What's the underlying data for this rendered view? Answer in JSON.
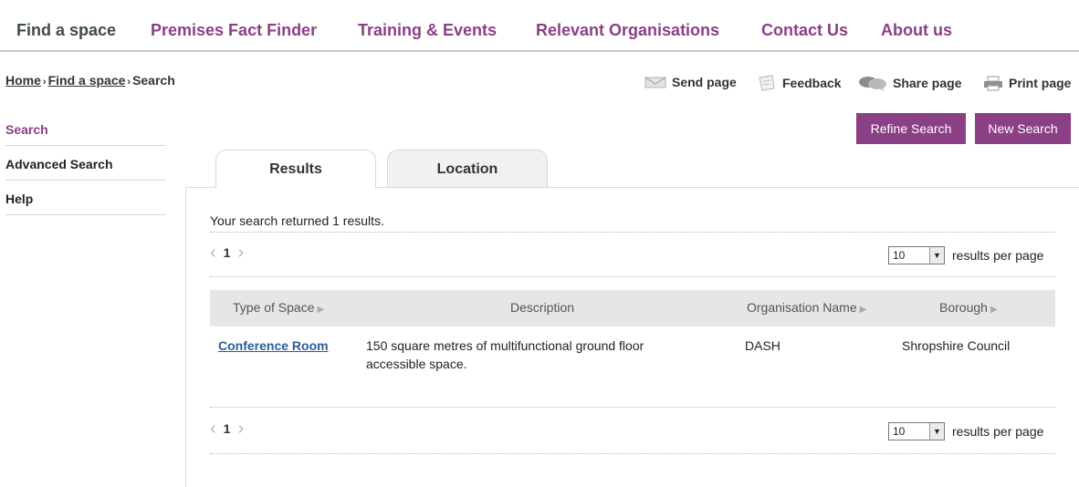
{
  "nav": {
    "items": [
      "Find a space",
      "Premises Fact Finder",
      "Training & Events",
      "Relevant Organisations",
      "Contact Us",
      "About us"
    ]
  },
  "breadcrumb": {
    "home": "Home",
    "find": "Find a space",
    "current": "Search"
  },
  "utility": {
    "send": "Send page",
    "feedback": "Feedback",
    "share": "Share page",
    "print": "Print page"
  },
  "sidebar": {
    "items": [
      "Search",
      "Advanced Search",
      "Help"
    ]
  },
  "buttons": {
    "refine": "Refine Search",
    "new": "New Search"
  },
  "tabs": {
    "results": "Results",
    "location": "Location"
  },
  "results": {
    "summary": "Your search returned 1 results.",
    "page": "1",
    "per_page_value": "10",
    "per_page_label": "results per page"
  },
  "table": {
    "headers": [
      "Type of Space",
      "Description",
      "Organisation Name",
      "Borough"
    ],
    "rows": [
      {
        "type": "Conference Room",
        "description_line1": "150 square metres of multifunctional ground floor",
        "description_line2": "accessible space.",
        "organisation": "DASH",
        "borough": "Shropshire Council"
      }
    ]
  },
  "colors": {
    "brand": "#8b3f84",
    "link": "#2b5d99"
  }
}
